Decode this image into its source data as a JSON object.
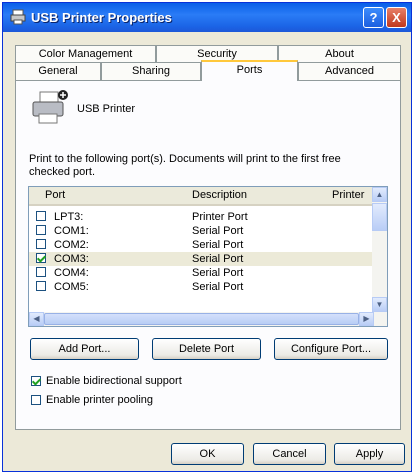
{
  "window": {
    "title": "USB Printer Properties"
  },
  "titlebar_buttons": {
    "help": "?",
    "close": "X"
  },
  "tabs_row1": [
    "Color Management",
    "Security",
    "About"
  ],
  "tabs_row2": [
    "General",
    "Sharing",
    "Ports",
    "Advanced"
  ],
  "active_tab": "Ports",
  "printer": {
    "name": "USB Printer"
  },
  "description": "Print to the following port(s). Documents will print to the first free checked port.",
  "ports_table": {
    "columns": [
      "Port",
      "Description",
      "Printer"
    ],
    "rows": [
      {
        "port": "LPT3:",
        "description": "Printer Port",
        "checked": false,
        "selected": false
      },
      {
        "port": "COM1:",
        "description": "Serial Port",
        "checked": false,
        "selected": false
      },
      {
        "port": "COM2:",
        "description": "Serial Port",
        "checked": false,
        "selected": false
      },
      {
        "port": "COM3:",
        "description": "Serial Port",
        "checked": true,
        "selected": true
      },
      {
        "port": "COM4:",
        "description": "Serial Port",
        "checked": false,
        "selected": false
      },
      {
        "port": "COM5:",
        "description": "Serial Port",
        "checked": false,
        "selected": false
      }
    ]
  },
  "port_buttons": {
    "add": "Add Port...",
    "delete": "Delete Port",
    "configure": "Configure Port..."
  },
  "options": {
    "bidirectional": {
      "label": "Enable bidirectional support",
      "checked": true
    },
    "pooling": {
      "label": "Enable printer pooling",
      "checked": false
    }
  },
  "dialog_buttons": {
    "ok": "OK",
    "cancel": "Cancel",
    "apply": "Apply"
  }
}
